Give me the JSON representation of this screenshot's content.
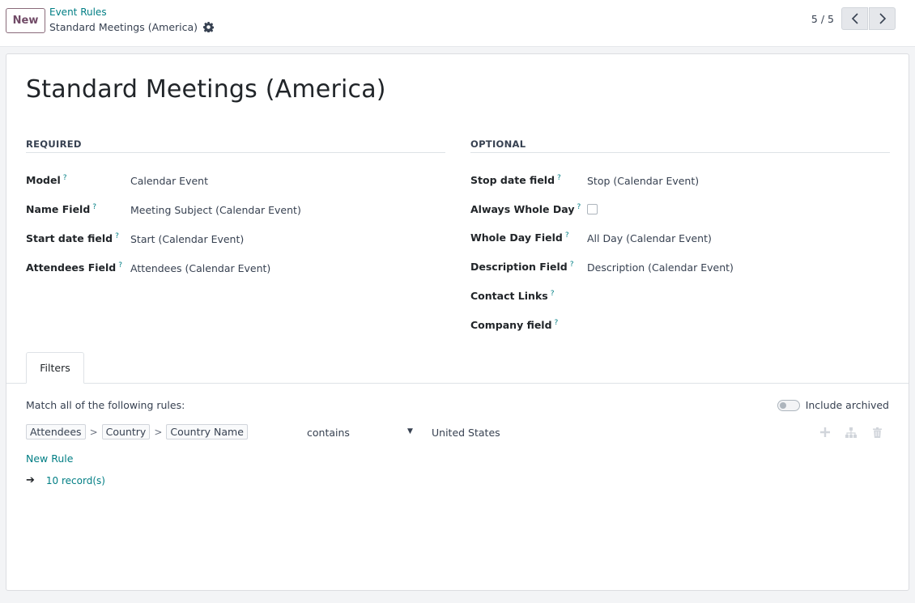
{
  "topbar": {
    "new_label": "New",
    "breadcrumb_parent": "Event Rules",
    "breadcrumb_current": "Standard Meetings (America)",
    "pager": "5 / 5"
  },
  "form": {
    "title": "Standard Meetings (America)",
    "required": {
      "heading": "REQUIRED",
      "fields": [
        {
          "label": "Model",
          "value": "Calendar Event"
        },
        {
          "label": "Name Field",
          "value": "Meeting Subject (Calendar Event)"
        },
        {
          "label": "Start date field",
          "value": "Start (Calendar Event)"
        },
        {
          "label": "Attendees Field",
          "value": "Attendees (Calendar Event)"
        }
      ]
    },
    "optional": {
      "heading": "OPTIONAL",
      "fields": [
        {
          "label": "Stop date field",
          "value": "Stop (Calendar Event)"
        },
        {
          "label": "Always Whole Day",
          "value": "",
          "checked": false
        },
        {
          "label": "Whole Day Field",
          "value": "All Day (Calendar Event)"
        },
        {
          "label": "Description Field",
          "value": "Description (Calendar Event)"
        },
        {
          "label": "Contact Links",
          "value": ""
        },
        {
          "label": "Company field",
          "value": ""
        }
      ]
    },
    "help_marker": "?"
  },
  "filters": {
    "tab_label": "Filters",
    "match_text": "Match all of the following rules:",
    "include_archived": "Include archived",
    "include_archived_on": false,
    "rule": {
      "path": [
        "Attendees",
        "Country",
        "Country Name"
      ],
      "path_separator": ">",
      "operator": "contains",
      "value": "United States"
    },
    "new_rule": "New Rule",
    "records": "10 record(s)"
  },
  "colors": {
    "brand": "#714b67",
    "link": "#017e84"
  }
}
